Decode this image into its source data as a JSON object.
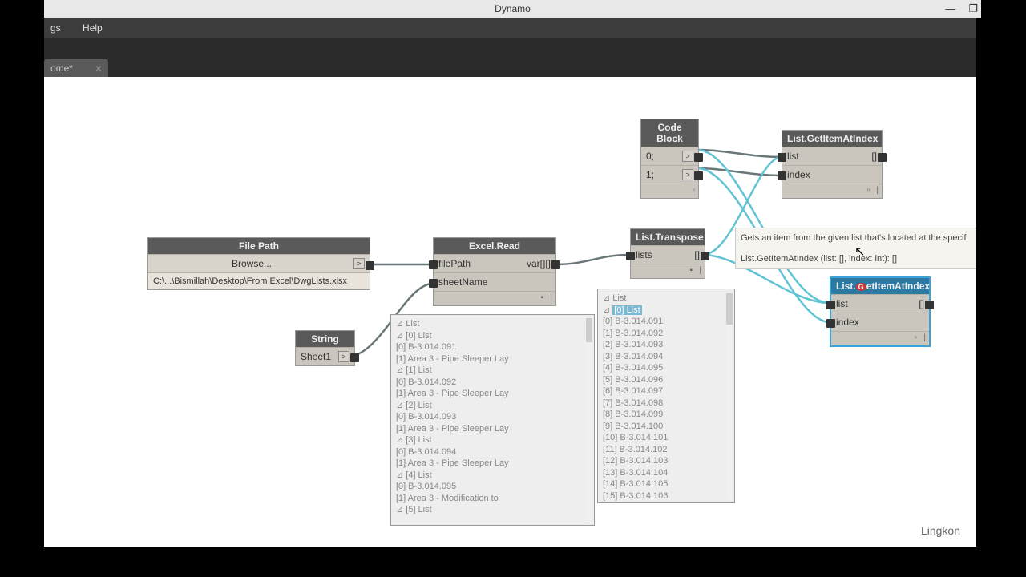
{
  "window": {
    "title": "Dynamo",
    "min": "—",
    "max": "❐"
  },
  "menu": {
    "settings_frag": "gs",
    "help": "Help"
  },
  "tab": {
    "name_frag": "ome*",
    "close": "×"
  },
  "nodes": {
    "filepath": {
      "title": "File Path",
      "browse": "Browse...",
      "path": "C:\\...\\Bismillah\\Desktop\\From Excel\\DwgLists.xlsx"
    },
    "string": {
      "title": "String",
      "value": "Sheet1"
    },
    "excel": {
      "title": "Excel.Read",
      "p1": "filePath",
      "p2": "sheetName",
      "out": "var[][]"
    },
    "codeblock": {
      "title": "Code Block",
      "l1": "0;",
      "l2": "1;"
    },
    "transpose": {
      "title": "List.Transpose",
      "p1": "lists",
      "out": "[]"
    },
    "getitem1": {
      "title": "List.GetItemAtIndex",
      "p1": "list",
      "p2": "index",
      "out": "[]"
    },
    "getitem2": {
      "title": "List.GetItemAtIndex",
      "p1": "list",
      "p2": "index",
      "out": "[]"
    }
  },
  "tooltip": {
    "line1": "Gets an item from the given list that's located at the specif",
    "line2": "List.GetItemAtIndex (list: [], index: int): []"
  },
  "excel_preview": [
    "⊿  List",
    "   ⊿  [0] List",
    "         [0] B-3.014.091",
    "         [1] Area 3 - Pipe Sleeper Lay",
    "   ⊿  [1] List",
    "         [0] B-3.014.092",
    "         [1] Area 3 - Pipe Sleeper Lay",
    "   ⊿  [2] List",
    "         [0] B-3.014.093",
    "         [1] Area 3 - Pipe Sleeper Lay",
    "   ⊿  [3] List",
    "         [0] B-3.014.094",
    "         [1] Area 3 - Pipe Sleeper Lay",
    "   ⊿  [4] List",
    "         [0] B-3.014.095",
    "         [1] Area 3 - Modification to",
    "   ⊿  [5] List"
  ],
  "transpose_preview": {
    "head1": "⊿  List",
    "head2_prefix": "   ⊿ ",
    "head2_hl": "[0] List",
    "items": [
      "         [0] B-3.014.091",
      "         [1] B-3.014.092",
      "         [2] B-3.014.093",
      "         [3] B-3.014.094",
      "         [4] B-3.014.095",
      "         [5] B-3.014.096",
      "         [6] B-3.014.097",
      "         [7] B-3.014.098",
      "         [8] B-3.014.099",
      "         [9] B-3.014.100",
      "         [10] B-3.014.101",
      "         [11] B-3.014.102",
      "         [12] B-3.014.103",
      "         [13] B-3.014.104",
      "         [14] B-3.014.105",
      "         [15] B-3.014.106"
    ]
  },
  "watermark": "Lingkon"
}
